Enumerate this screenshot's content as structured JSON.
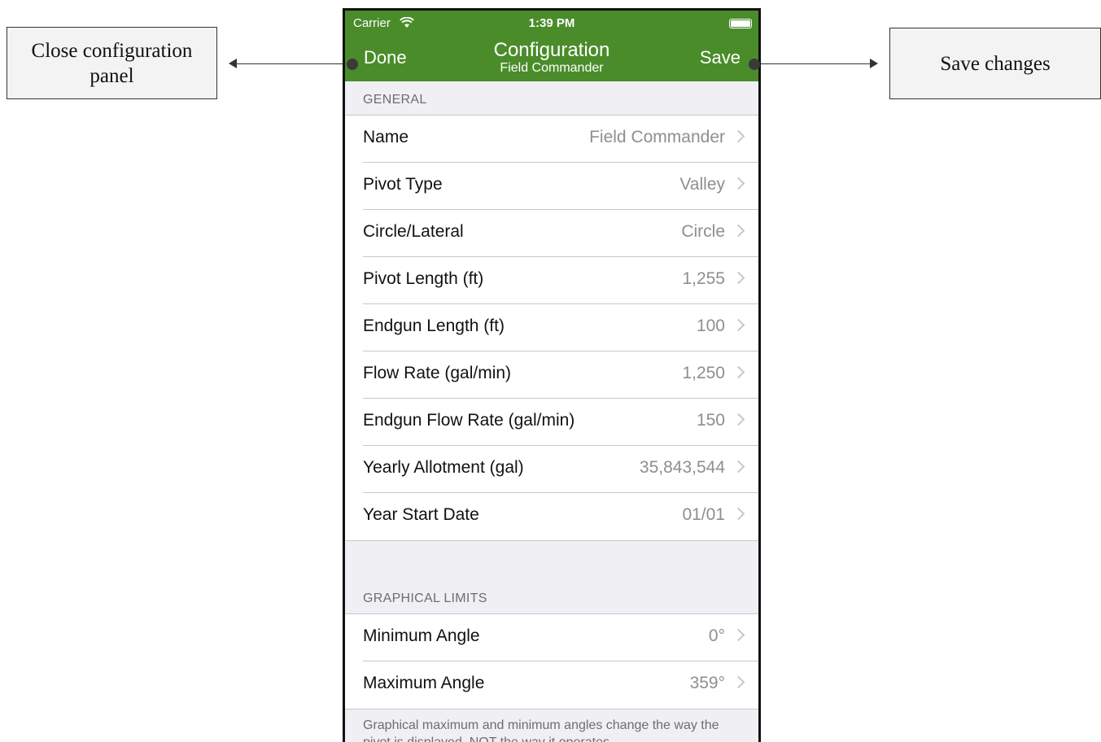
{
  "callouts": {
    "left": [
      "Close configuration",
      "panel"
    ],
    "right": "Save changes"
  },
  "status_bar": {
    "carrier": "Carrier",
    "time": "1:39 PM"
  },
  "nav": {
    "done_label": "Done",
    "title": "Configuration",
    "subtitle": "Field Commander",
    "save_label": "Save",
    "bar_color": "#4a8c2a"
  },
  "general": {
    "header": "GENERAL",
    "rows": [
      {
        "label": "Name",
        "value": "Field Commander"
      },
      {
        "label": "Pivot Type",
        "value": "Valley"
      },
      {
        "label": "Circle/Lateral",
        "value": "Circle"
      },
      {
        "label": "Pivot Length (ft)",
        "value": "1,255"
      },
      {
        "label": "Endgun Length (ft)",
        "value": "100"
      },
      {
        "label": "Flow Rate (gal/min)",
        "value": "1,250"
      },
      {
        "label": "Endgun Flow Rate (gal/min)",
        "value": "150"
      },
      {
        "label": "Yearly Allotment (gal)",
        "value": "35,843,544"
      },
      {
        "label": "Year Start Date",
        "value": "01/01"
      }
    ]
  },
  "graphical_limits": {
    "header": "GRAPHICAL LIMITS",
    "rows": [
      {
        "label": "Minimum Angle",
        "value": "0°"
      },
      {
        "label": "Maximum Angle",
        "value": "359°"
      }
    ],
    "footer": "Graphical maximum and minimum angles change the way the pivot is displayed, NOT the way it operates."
  }
}
